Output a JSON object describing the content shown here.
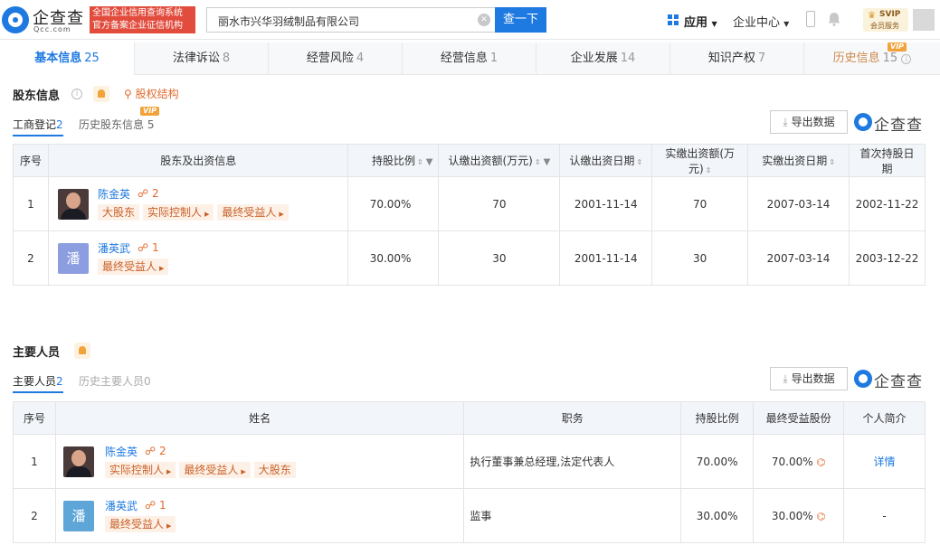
{
  "header": {
    "logo_cn": "企查查",
    "logo_en": "Qcc.com",
    "badge_line1": "全国企业信用查询系统",
    "badge_line2": "官方备案企业征信机构",
    "search_value": "丽水市兴华羽绒制品有限公司",
    "search_button": "查一下",
    "nav_app": "应用",
    "nav_enterprise": "企业中心",
    "svip_title": "SVIP",
    "svip_sub": "会员服务"
  },
  "tabs": [
    {
      "label": "基本信息",
      "count": "25"
    },
    {
      "label": "法律诉讼",
      "count": "8"
    },
    {
      "label": "经营风险",
      "count": "4"
    },
    {
      "label": "经营信息",
      "count": "1"
    },
    {
      "label": "企业发展",
      "count": "14"
    },
    {
      "label": "知识产权",
      "count": "7"
    },
    {
      "label": "历史信息",
      "count": "15"
    }
  ],
  "vip_label": "VIP",
  "shareholders": {
    "title": "股东信息",
    "equity_link": "股权结构",
    "subtab_active": "工商登记",
    "subtab_active_count": "2",
    "subtab_history": "历史股东信息",
    "subtab_history_count": "5",
    "export_label": "导出数据",
    "brand": "企查查",
    "columns": [
      "序号",
      "股东及出资信息",
      "持股比例",
      "认缴出资额(万元)",
      "认缴出资日期",
      "实缴出资额(万元)",
      "实缴出资日期",
      "首次持股日期"
    ],
    "rows": [
      {
        "no": "1",
        "name": "陈金英",
        "links": "2",
        "tags": [
          "大股东",
          "实际控制人",
          "最终受益人"
        ],
        "ratio": "70.00%",
        "sub_amount": "70",
        "sub_date": "2001-11-14",
        "paid_amount": "70",
        "paid_date": "2007-03-14",
        "first_date": "2002-11-22"
      },
      {
        "no": "2",
        "name": "潘英武",
        "avatar_char": "潘",
        "links": "1",
        "tags": [
          "最终受益人"
        ],
        "ratio": "30.00%",
        "sub_amount": "30",
        "sub_date": "2001-11-14",
        "paid_amount": "30",
        "paid_date": "2007-03-14",
        "first_date": "2003-12-22"
      }
    ]
  },
  "personnel": {
    "title": "主要人员",
    "subtab_active": "主要人员",
    "subtab_active_count": "2",
    "subtab_history": "历史主要人员",
    "subtab_history_count": "0",
    "export_label": "导出数据",
    "brand": "企查查",
    "columns": [
      "序号",
      "姓名",
      "职务",
      "持股比例",
      "最终受益股份",
      "个人简介"
    ],
    "rows": [
      {
        "no": "1",
        "name": "陈金英",
        "links": "2",
        "tags": [
          "实际控制人",
          "最终受益人",
          "大股东"
        ],
        "position": "执行董事兼总经理,法定代表人",
        "ratio": "70.00%",
        "benefit": "70.00%",
        "profile": "详情"
      },
      {
        "no": "2",
        "name": "潘英武",
        "avatar_char": "潘",
        "links": "1",
        "tags": [
          "最终受益人"
        ],
        "position": "监事",
        "ratio": "30.00%",
        "benefit": "30.00%",
        "profile": "-"
      }
    ]
  }
}
